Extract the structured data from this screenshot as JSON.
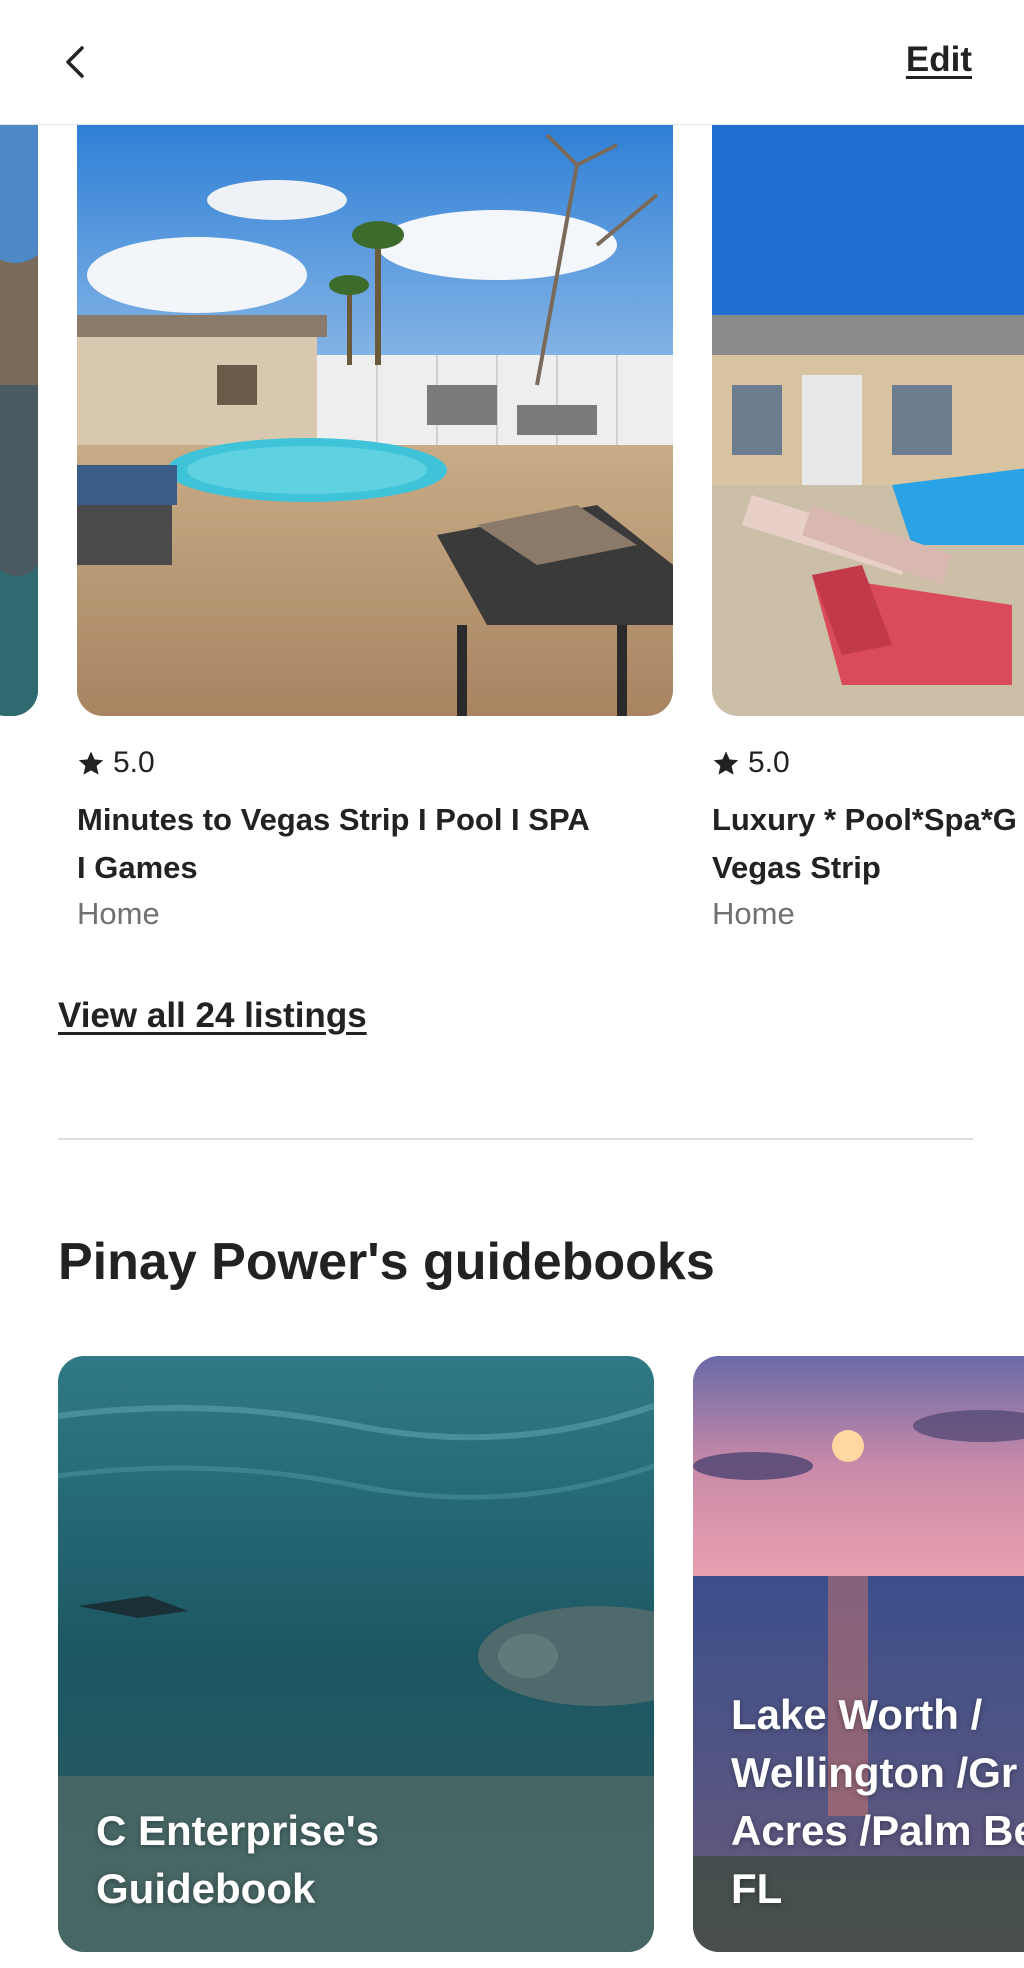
{
  "header": {
    "back_icon": "chevron-left-icon",
    "edit_label": "Edit"
  },
  "listings": [
    {
      "rating": "5.0",
      "title_line1": "Minutes to Vegas Strip I Pool I SPA",
      "title_line2": "I Games",
      "type": "Home"
    },
    {
      "rating": "5.0",
      "title_line1": "Luxury * Pool*Spa*G",
      "title_line2": "Vegas Strip",
      "type": "Home"
    }
  ],
  "view_all_label": "View all 24 listings",
  "guidebooks": {
    "section_title": "Pinay Power's guidebooks",
    "items": [
      {
        "title_line1": "C Enterprise's",
        "title_line2": "Guidebook"
      },
      {
        "title_line1": "Lake Worth /",
        "title_line2": "Wellington /Gr",
        "title_line3": "Acres /Palm Be",
        "title_line4": "FL"
      }
    ]
  },
  "colors": {
    "text": "#222222",
    "muted": "#717171",
    "divider": "#dddddd",
    "sky": "#2f7fd6",
    "pool": "#3fc3d8"
  }
}
